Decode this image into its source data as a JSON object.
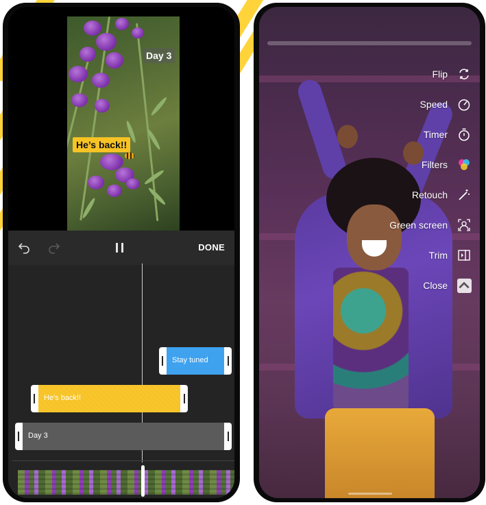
{
  "editor": {
    "stickers": {
      "day3": "Day 3",
      "hes_back": "He’s back!!"
    },
    "toolbar": {
      "undo_icon": "undo-icon",
      "redo_icon": "redo-icon",
      "pause_icon": "pause-icon",
      "done_label": "DONE"
    },
    "timeline": {
      "clips": [
        {
          "label": "Stay tuned",
          "color": "#3ea2ef"
        },
        {
          "label": "He's back!!",
          "color": "#f7c325"
        },
        {
          "label": "Day 3",
          "color": "#5b5b5b"
        }
      ]
    }
  },
  "tools": {
    "items": [
      {
        "label": "Flip",
        "icon": "flip-icon"
      },
      {
        "label": "Speed",
        "icon": "speed-icon"
      },
      {
        "label": "Timer",
        "icon": "timer-icon"
      },
      {
        "label": "Filters",
        "icon": "filters-icon"
      },
      {
        "label": "Retouch",
        "icon": "retouch-icon"
      },
      {
        "label": "Green screen",
        "icon": "green-screen-icon"
      },
      {
        "label": "Trim",
        "icon": "trim-icon"
      },
      {
        "label": "Close",
        "icon": "chevron-up-icon"
      }
    ]
  },
  "colors": {
    "accent_yellow": "#ffd43b",
    "clip_blue": "#3ea2ef",
    "clip_yellow": "#f7c325"
  }
}
